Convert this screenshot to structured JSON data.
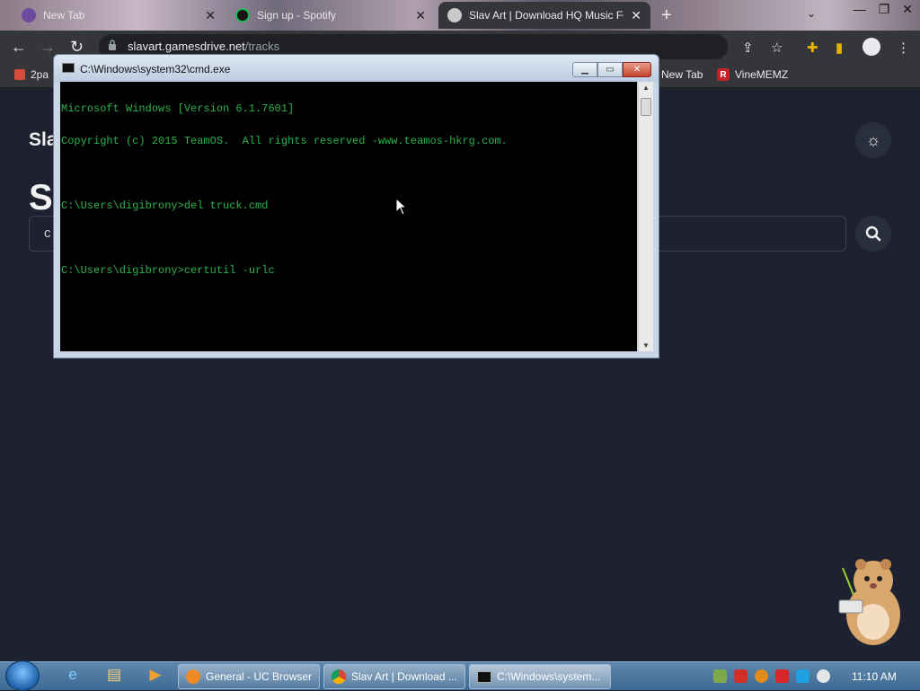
{
  "browser": {
    "tabs": [
      {
        "title": "New Tab",
        "active": false
      },
      {
        "title": "Sign up - Spotify",
        "active": false
      },
      {
        "title": "Slav Art | Download HQ Music Fo",
        "active": true
      }
    ],
    "url_domain": "slavart.gamesdrive.net",
    "url_path": "/tracks",
    "bookmarks": [
      {
        "label": "2pa"
      },
      {
        "label": "New Tab"
      },
      {
        "label": "VineMEMZ"
      }
    ]
  },
  "page": {
    "logo_text": "Sla",
    "heading_text": "Se",
    "search_value": "c"
  },
  "cmd": {
    "title": "C:\\Windows\\system32\\cmd.exe",
    "lines": [
      "Microsoft Windows [Version 6.1.7601]",
      "Copyright (c) 2015 TeamOS.  All rights reserved -www.teamos-hkrg.com.",
      "",
      "C:\\Users\\digibrony>del truck.cmd",
      "",
      "C:\\Users\\digibrony>certutil -urlc"
    ],
    "text_color": "#2bb24c"
  },
  "taskbar": {
    "tasks": [
      {
        "label": "General - UC Browser",
        "icon": "uc-browser-icon"
      },
      {
        "label": "Slav Art | Download ...",
        "icon": "chrome-icon"
      },
      {
        "label": "C:\\Windows\\system...",
        "icon": "cmd-icon"
      }
    ],
    "clock": "11:10 AM"
  },
  "colors": {
    "page_bg": "#1e2230",
    "chrome_toolbar": "#35363a",
    "taskbar": "#3e6a93"
  }
}
